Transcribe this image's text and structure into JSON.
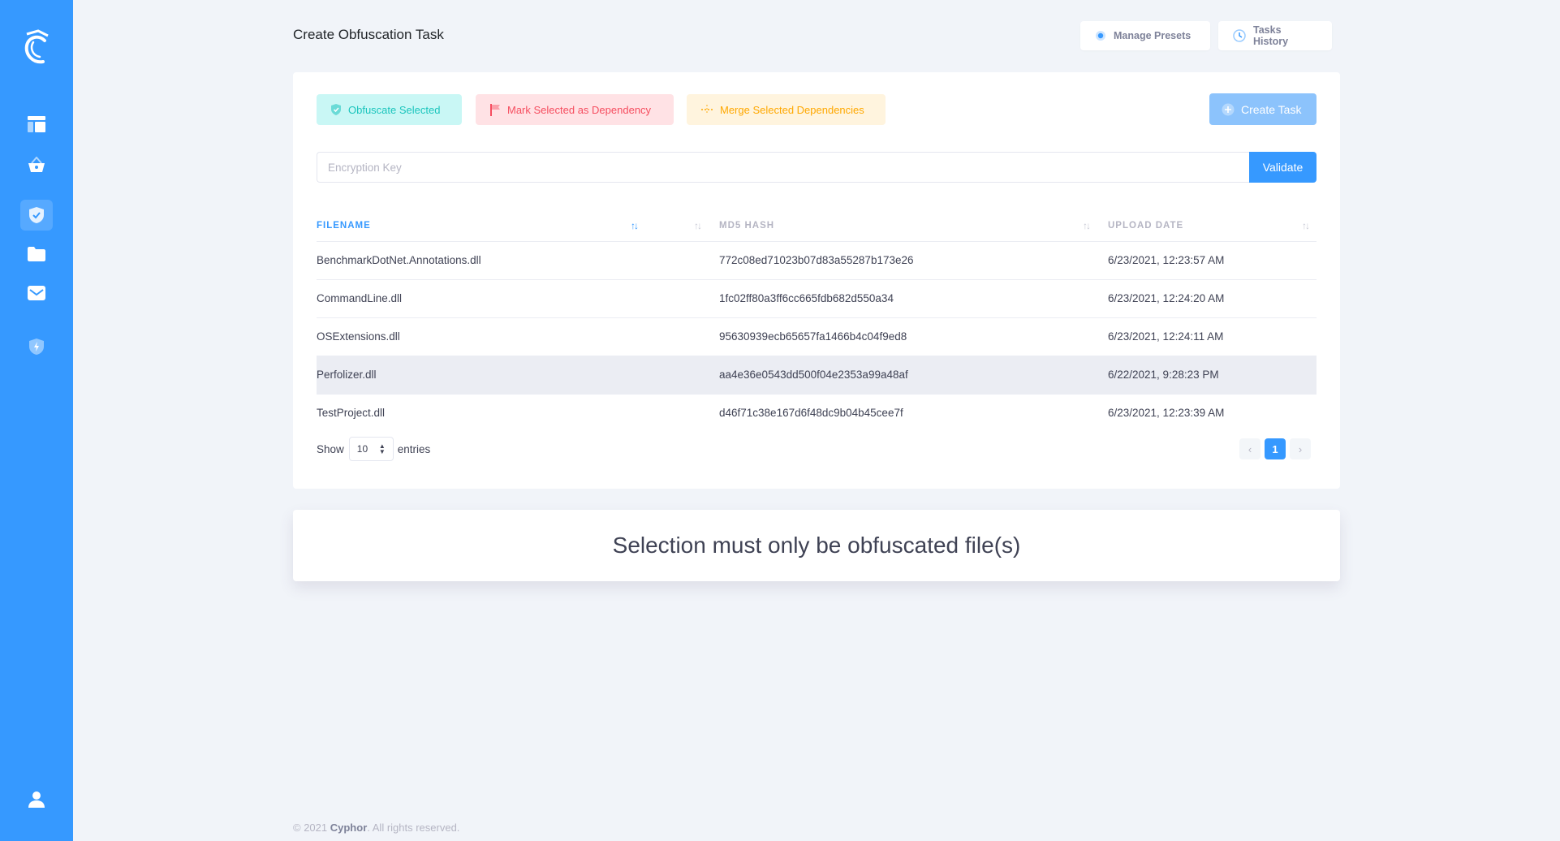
{
  "sidebar": {
    "items": [
      {
        "icon": "layout-icon"
      },
      {
        "icon": "basket-icon"
      },
      {
        "icon": "shield-check-icon"
      },
      {
        "icon": "folder-icon"
      },
      {
        "icon": "inbox-icon"
      },
      {
        "icon": "shield-lightning-icon"
      },
      {
        "icon": "user-icon"
      }
    ],
    "active_index": 2
  },
  "header": {
    "title": "Create Obfuscation Task",
    "manage_presets": "Manage Presets",
    "tasks_history": "Tasks History"
  },
  "actions": {
    "obfuscate_selected": "Obfuscate Selected",
    "mark_dependency": "Mark Selected as Dependency",
    "merge_dependencies": "Merge Selected Dependencies",
    "create_task": "Create Task"
  },
  "encryption": {
    "placeholder": "Encryption Key",
    "validate": "Validate"
  },
  "table": {
    "headers": [
      "FILENAME",
      "MD5 HASH",
      "UPLOAD DATE"
    ],
    "rows": [
      {
        "filename": "BenchmarkDotNet.Annotations.dll",
        "md5": "772c08ed71023b07d83a55287b173e26",
        "date": "6/23/2021, 12:23:57 AM"
      },
      {
        "filename": "CommandLine.dll",
        "md5": "1fc02ff80a3ff6cc665fdb682d550a34",
        "date": "6/23/2021, 12:24:20 AM"
      },
      {
        "filename": "OSExtensions.dll",
        "md5": "95630939ecb65657fa1466b4c04f9ed8",
        "date": "6/23/2021, 12:24:11 AM"
      },
      {
        "filename": "Perfolizer.dll",
        "md5": "aa4e36e0543dd500f04e2353a99a48af",
        "date": "6/22/2021, 9:28:23 PM"
      },
      {
        "filename": "TestProject.dll",
        "md5": "d46f71c38e167d6f48dc9b04b45cee7f",
        "date": "6/23/2021, 12:23:39 AM"
      }
    ],
    "highlighted_row": 3
  },
  "pagination": {
    "show_label": "Show",
    "page_size": "10",
    "entries_label": "entries",
    "prev": "‹",
    "current_page": "1",
    "next": "›"
  },
  "message": "Selection must only be obfuscated file(s)",
  "footer": {
    "copyright": "© 2021",
    "brand": "Cyphor",
    "rights": ". All rights reserved."
  },
  "colors": {
    "primary": "#3699ff",
    "success_light": "#c9f7f5",
    "danger_light": "#ffe2e5",
    "warning_light": "#fff4de",
    "background": "#f1f4f9"
  }
}
